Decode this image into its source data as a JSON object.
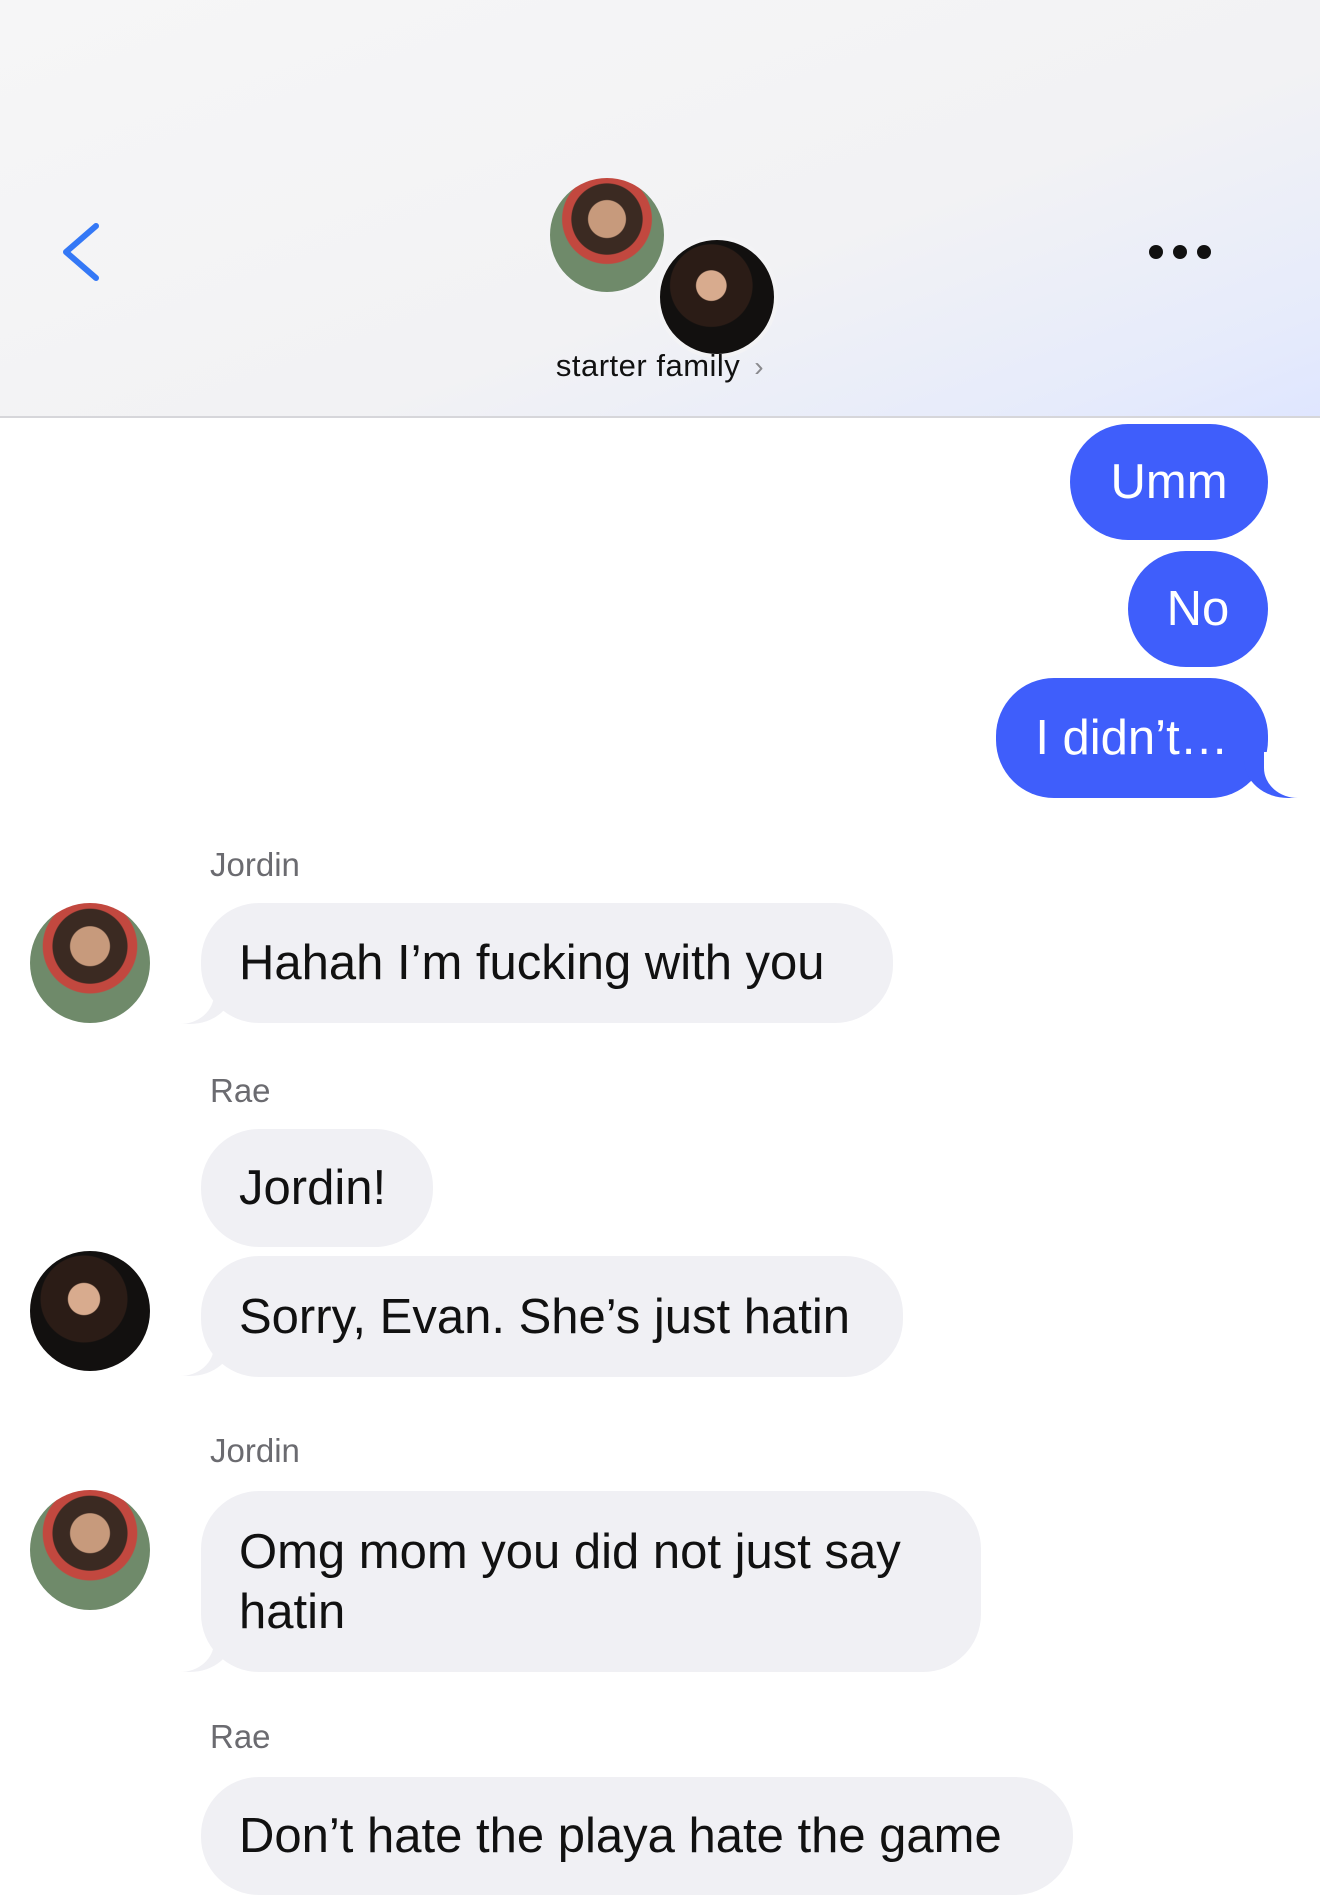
{
  "header": {
    "group_name": "starter family",
    "chevron": "›",
    "back_icon": "chevron-left-icon",
    "more_icon": "ellipsis-icon",
    "accent_color": "#3f5efb"
  },
  "messages": [
    {
      "from": "me",
      "text": "Umm"
    },
    {
      "from": "me",
      "text": "No"
    },
    {
      "from": "me",
      "text": "I didn’t…"
    },
    {
      "sender": "Jordin",
      "text": "Hahah I’m fucking with you"
    },
    {
      "sender": "Rae",
      "text": "Jordin!"
    },
    {
      "sender": "Rae",
      "text": "Sorry, Evan. She’s just hatin"
    },
    {
      "sender": "Jordin",
      "text": "Omg mom you did not just say hatin"
    },
    {
      "sender": "Rae",
      "text": "Don’t hate the playa hate the game"
    }
  ]
}
